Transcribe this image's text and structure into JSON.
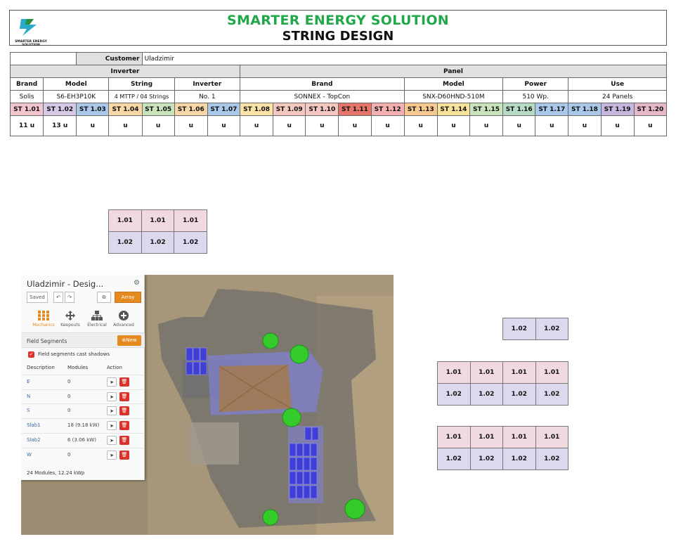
{
  "header": {
    "logo_text": "SMARTER ENERGY SOLUTION",
    "title": "SMARTER ENERGY SOLUTION",
    "subtitle": "STRING DESIGN"
  },
  "customer": {
    "label": "Customer",
    "value": "Uladzimir"
  },
  "sections": {
    "inverter": "Inverter",
    "panel": "Panel"
  },
  "inverter_headers": [
    "Brand",
    "Model",
    "String",
    "Inverter"
  ],
  "panel_headers": [
    "Brand",
    "Model",
    "Power",
    "Use"
  ],
  "inverter_values": [
    "Solis",
    "S6-EH3P10K",
    "4 MTTP / 04 Strings",
    "No. 1"
  ],
  "panel_values": [
    "SONNEX - TopCon",
    "SNX-D60HND-510M",
    "510 Wp.",
    "24 Panels"
  ],
  "strings": [
    "ST 1.01",
    "ST 1.02",
    "ST 1.03",
    "ST 1.04",
    "ST 1.05",
    "ST 1.06",
    "ST 1.07",
    "ST 1.08",
    "ST 1.09",
    "ST 1.10",
    "ST 1.11",
    "ST 1.12",
    "ST 1.13",
    "ST 1.14",
    "ST 1.15",
    "ST 1.16",
    "ST 1.17",
    "ST 1.18",
    "ST 1.19",
    "ST 1.20"
  ],
  "string_colors": [
    "#f2c4ce",
    "#d5cbe7",
    "#a9c8ea",
    "#f7d7a6",
    "#c9e3bd",
    "#f7d7a6",
    "#a9c8ea",
    "#fbe3a7",
    "#f4c8c0",
    "#f4c8c0",
    "#e5756b",
    "#f4b0b0",
    "#f7c98f",
    "#f6e39b",
    "#c9e3bd",
    "#b7dcc6",
    "#a9c8ea",
    "#a9c8ea",
    "#c6b7df",
    "#e6b7c8"
  ],
  "string_values": [
    "11 u",
    "13 u",
    "u",
    "u",
    "u",
    "u",
    "u",
    "u",
    "u",
    "u",
    "u",
    "u",
    "u",
    "u",
    "u",
    "u",
    "u",
    "u",
    "u",
    "u"
  ],
  "layout_a": [
    [
      "1.01",
      "1.01",
      "1.01"
    ],
    [
      "1.02",
      "1.02",
      "1.02"
    ]
  ],
  "layout_b": [
    [
      "1.02",
      "1.02"
    ]
  ],
  "layout_c": [
    [
      "1.01",
      "1.01",
      "1.01",
      "1.01"
    ],
    [
      "1.02",
      "1.02",
      "1.02",
      "1.02"
    ]
  ],
  "layout_d": [
    [
      "1.01",
      "1.01",
      "1.01",
      "1.01"
    ],
    [
      "1.02",
      "1.02",
      "1.02",
      "1.02"
    ]
  ],
  "app": {
    "title": "Uladzimir - Desig...",
    "saved": "Saved",
    "array_btn": "Array",
    "tabs": [
      "Mechanics",
      "Keepouts",
      "Electrical",
      "Advanced"
    ],
    "field_segments": "Field Segments",
    "new_btn": "New",
    "shadow_label": "Field segments cast shadows",
    "col_desc": "Description",
    "col_modules": "Modules",
    "col_action": "Action",
    "rows": [
      {
        "desc": "E",
        "modules": "0"
      },
      {
        "desc": "N",
        "modules": "0"
      },
      {
        "desc": "S",
        "modules": "0"
      },
      {
        "desc": "Slab1",
        "modules": "18 (9.18 kW)"
      },
      {
        "desc": "Slab2",
        "modules": "6 (3.06 kW)"
      },
      {
        "desc": "W",
        "modules": "0"
      }
    ],
    "summary": "24 Modules, 12.24 kWp"
  }
}
